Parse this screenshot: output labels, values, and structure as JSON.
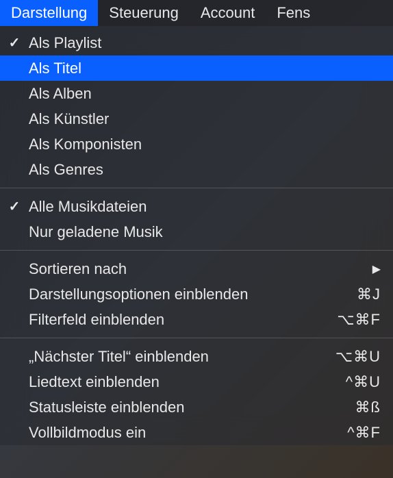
{
  "menubar": {
    "items": [
      {
        "label": "Darstellung",
        "active": true
      },
      {
        "label": "Steuerung",
        "active": false
      },
      {
        "label": "Account",
        "active": false
      },
      {
        "label": "Fens",
        "active": false
      }
    ]
  },
  "dropdown": {
    "sections": [
      [
        {
          "label": "Als Playlist",
          "checked": true,
          "highlighted": false
        },
        {
          "label": "Als Titel",
          "checked": false,
          "highlighted": true
        },
        {
          "label": "Als Alben",
          "checked": false,
          "highlighted": false
        },
        {
          "label": "Als Künstler",
          "checked": false,
          "highlighted": false
        },
        {
          "label": "Als Komponisten",
          "checked": false,
          "highlighted": false
        },
        {
          "label": "Als Genres",
          "checked": false,
          "highlighted": false
        }
      ],
      [
        {
          "label": "Alle Musikdateien",
          "checked": true,
          "highlighted": false
        },
        {
          "label": "Nur geladene Musik",
          "checked": false,
          "highlighted": false
        }
      ],
      [
        {
          "label": "Sortieren nach",
          "submenu": true
        },
        {
          "label": "Darstellungsoptionen einblenden",
          "shortcut": "⌘J"
        },
        {
          "label": "Filterfeld einblenden",
          "shortcut": "⌥⌘F"
        }
      ],
      [
        {
          "label": "„Nächster Titel“ einblenden",
          "shortcut": "⌥⌘U"
        },
        {
          "label": "Liedtext einblenden",
          "shortcut": "^⌘U"
        },
        {
          "label": "Statusleiste einblenden",
          "shortcut": "⌘ß"
        },
        {
          "label": "Vollbildmodus ein",
          "shortcut": "^⌘F"
        }
      ]
    ]
  }
}
